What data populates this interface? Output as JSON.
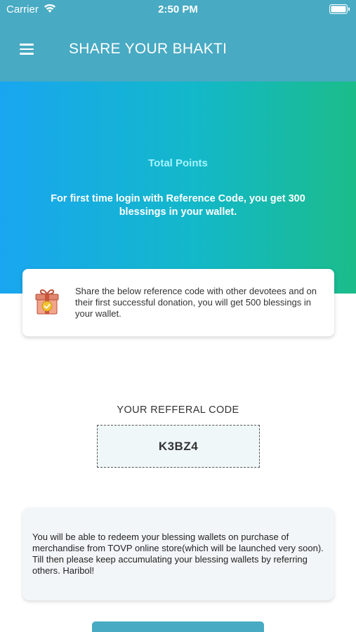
{
  "status_bar": {
    "carrier": "Carrier",
    "time": "2:50 PM"
  },
  "header": {
    "title": "SHARE YOUR BHAKTI",
    "background_color": "#48aac3"
  },
  "hero": {
    "total_points_label": "Total Points",
    "reference_text": "For first time login with Reference Code, you get 300 blessings in your wallet.",
    "gradient_start": "#19a6f0",
    "gradient_end": "#1bbc8a"
  },
  "info_card": {
    "icon": "gift-icon",
    "text": "Share the below reference code with other devotees and on their first successful donation, you will get 500 blessings in your wallet."
  },
  "referral": {
    "label": "YOUR REFFERAL CODE",
    "code": "K3BZ4"
  },
  "note": {
    "text": "You will be able to redeem your blessing wallets on purchase of merchandise from TOVP online store(which will be launched very soon). Till then please keep accumulating your blessing wallets by referring others. Haribol!"
  }
}
